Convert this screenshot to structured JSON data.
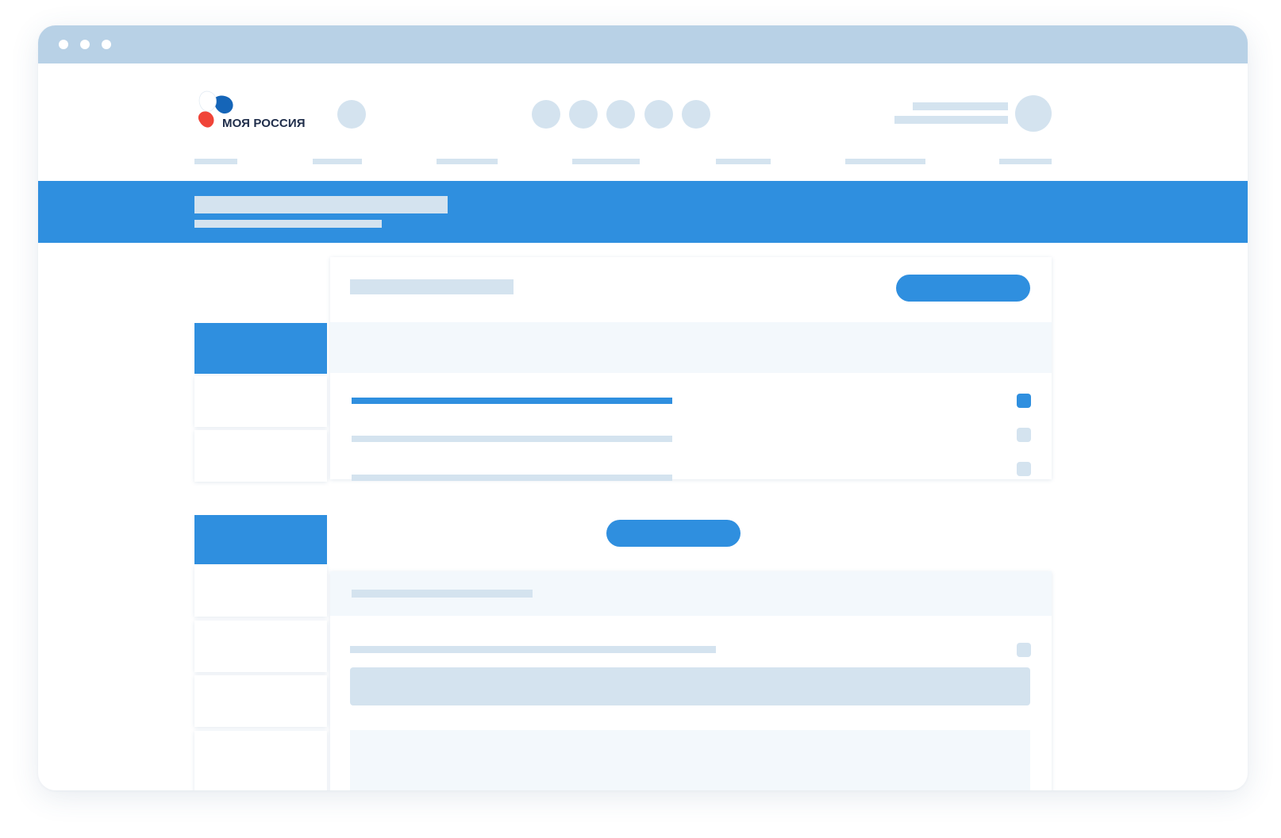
{
  "app": {
    "logo_text": "МОЯ РОССИЯ",
    "logo_colors": {
      "white": "#ffffff",
      "blue": "#1565b8",
      "red": "#f04438"
    }
  },
  "colors": {
    "accent": "#2f8fdf",
    "placeholder": "#d4e3ef",
    "titlebar": "#b8d1e6",
    "pale_panel": "#f3f8fc"
  },
  "checkboxes": [
    {
      "checked": true
    },
    {
      "checked": false
    },
    {
      "checked": false
    },
    {
      "checked": false
    }
  ]
}
